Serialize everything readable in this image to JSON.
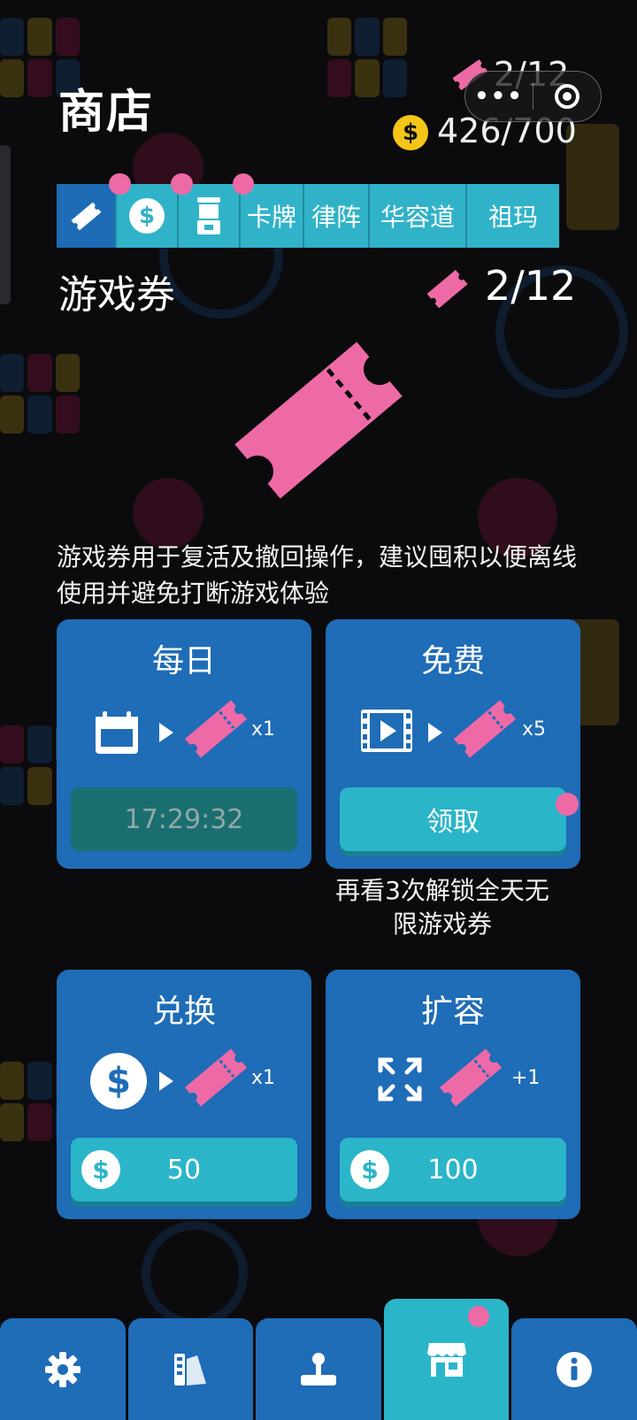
{
  "header": {
    "title": "商店",
    "tickets": "2/12",
    "coins": "426/700",
    "coin_symbol": "$",
    "capsule_menu_icon": "more-dots-icon",
    "capsule_close_icon": "target-close-icon"
  },
  "tabs": [
    {
      "id": "tickets",
      "icon": "ticket-icon",
      "label": "",
      "active": true
    },
    {
      "id": "coins",
      "icon": "coin-icon",
      "label": "$",
      "badge": true
    },
    {
      "id": "gacha",
      "icon": "gacha-machine-icon",
      "label": "",
      "badge": true
    },
    {
      "id": "cards",
      "label": "卡牌",
      "badge": true
    },
    {
      "id": "law",
      "label": "律阵"
    },
    {
      "id": "klotski",
      "label": "华容道"
    },
    {
      "id": "zuma",
      "label": "祖玛"
    }
  ],
  "section": {
    "title": "游戏券",
    "count": "2/12"
  },
  "description": "游戏券用于复活及撤回操作，建议囤积以便离线使用并避免打断游戏体验",
  "cards": {
    "daily": {
      "title": "每日",
      "multiplier": "x1",
      "button": "17:29:32",
      "icon": "calendar-icon"
    },
    "free": {
      "title": "免费",
      "multiplier": "x5",
      "button": "领取",
      "icon": "video-icon"
    },
    "exchange": {
      "title": "兑换",
      "multiplier": "x1",
      "button": "50",
      "icon": "coin-icon"
    },
    "expand": {
      "title": "扩容",
      "multiplier": "+1",
      "button": "100",
      "icon": "expand-icon"
    }
  },
  "note": "再看3次解锁全天无限游戏券",
  "bottom_nav": [
    {
      "id": "settings",
      "icon": "gear-icon"
    },
    {
      "id": "themes",
      "icon": "palette-icon"
    },
    {
      "id": "games",
      "icon": "joystick-icon"
    },
    {
      "id": "shop",
      "icon": "store-icon",
      "active": true,
      "badge": true
    },
    {
      "id": "info",
      "icon": "info-icon"
    }
  ],
  "colors": {
    "accent_pink": "#ee6aa7",
    "card_blue": "#1f6cb7",
    "teal": "#2bb5c9",
    "gold": "#f5c518"
  }
}
